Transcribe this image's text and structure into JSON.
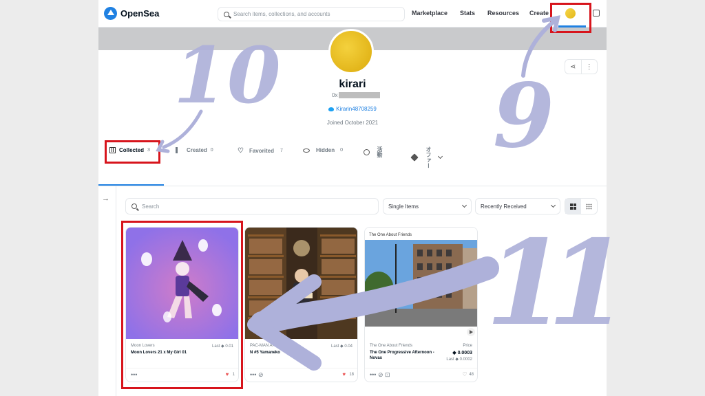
{
  "header": {
    "logo_text": "OpenSea",
    "search_placeholder": "Search items, collections, and accounts",
    "nav": [
      "Marketplace",
      "Stats",
      "Resources",
      "Create"
    ]
  },
  "profile": {
    "name": "kirari",
    "address_prefix": "0x",
    "twitter": "Kirarin48708259",
    "joined": "Joined October 2021"
  },
  "tabs": [
    {
      "label": "Collected",
      "count": "3"
    },
    {
      "label": "Created",
      "count": "0"
    },
    {
      "label": "Favorited",
      "count": "7"
    },
    {
      "label": "Hidden",
      "count": "0"
    },
    {
      "label": "活動",
      "count": ""
    },
    {
      "label": "オファー",
      "count": ""
    }
  ],
  "filters": {
    "search_placeholder": "Search",
    "type_select": "Single Items",
    "sort_select": "Recently Received"
  },
  "cards": [
    {
      "collection": "Moon Lovers",
      "name": "Moon Lovers 21 x My Girl 01",
      "price_label": "Last",
      "price": "0.01",
      "price2": "",
      "likes": "1"
    },
    {
      "collection": "PAC-MAN ART",
      "name": "N #5 Yamaneko",
      "price_label": "Last",
      "price": "0.04",
      "price2": "",
      "likes": "18"
    },
    {
      "collection": "The One About Friends",
      "name": "The One Progressive Afternoon - Novas",
      "price_label": "Price",
      "price": "0.0003",
      "price2": "Last ◆ 0.0002",
      "likes": "48"
    }
  ],
  "card3_image_caption": "The One About Friends",
  "annotations": {
    "n9": "9",
    "n10": "10",
    "n11": "11"
  },
  "colors": {
    "accent": "#2081e2",
    "highlight": "#d7141c",
    "annotation": "#aeb1da"
  }
}
